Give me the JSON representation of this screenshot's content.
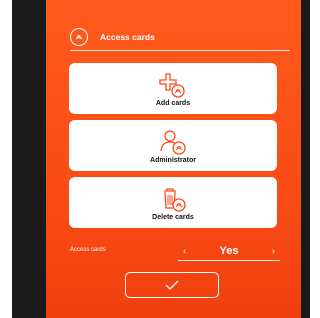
{
  "header": {
    "title": "Access cards",
    "icon": "contactless-card-icon"
  },
  "cards": [
    {
      "label": "Add cards",
      "icon": "add-card-icon"
    },
    {
      "label": "Administrator",
      "icon": "admin-user-card-icon"
    },
    {
      "label": "Delete cards",
      "icon": "trash-card-icon"
    }
  ],
  "setting": {
    "label": "Access cards",
    "value": "Yes",
    "prev_icon": "chevron-left-icon",
    "next_icon": "chevron-right-icon"
  },
  "confirm": {
    "icon": "check-icon"
  },
  "colors": {
    "accent": "#f94c17",
    "panel": "#ffffff",
    "frame": "#1a1a1a"
  }
}
